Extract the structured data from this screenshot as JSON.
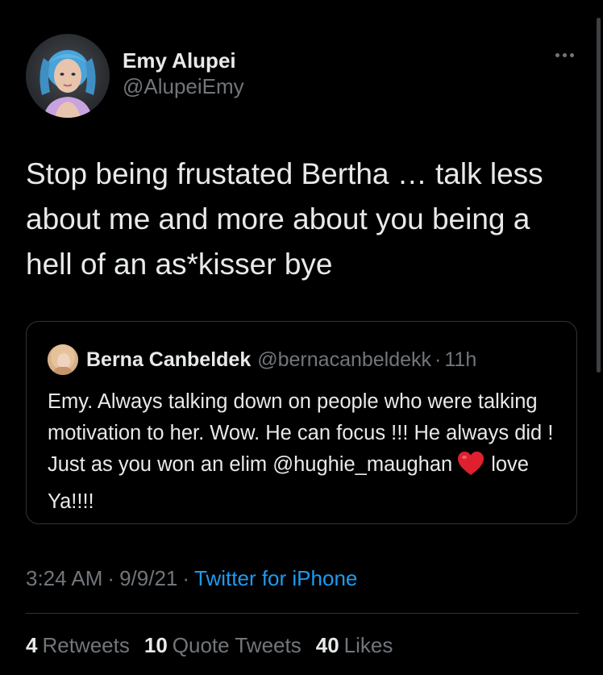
{
  "author": {
    "display_name": "Emy Alupei",
    "handle": "@AlupeiEmy"
  },
  "tweet": {
    "text": "Stop being frustated Bertha … talk less about me and more about you being a hell of an as*kisser bye"
  },
  "quoted_tweet": {
    "display_name": "Berna Canbeldek",
    "handle": "@bernacanbeldekk",
    "separator": "·",
    "time": "11h",
    "text_before_emoji": "Emy. Always talking down on people who were talking motivation to her. Wow. He can focus !!!   He always did !  Just as you won an elim @hughie_maughan",
    "text_after_emoji": "love Ya!!!!"
  },
  "meta": {
    "time": "3:24 AM",
    "separator": "·",
    "date": "9/9/21",
    "source": "Twitter for iPhone"
  },
  "stats": {
    "retweets_count": "4",
    "retweets_label": "Retweets",
    "quotes_count": "10",
    "quotes_label": "Quote Tweets",
    "likes_count": "40",
    "likes_label": "Likes"
  },
  "icons": {
    "more": "more-horizontal-icon",
    "emoji": "red-heart-emoji"
  },
  "colors": {
    "background": "#000000",
    "text": "#e7e9ea",
    "secondary": "#71767b",
    "link": "#1d9bf0",
    "border": "#2f3336"
  }
}
